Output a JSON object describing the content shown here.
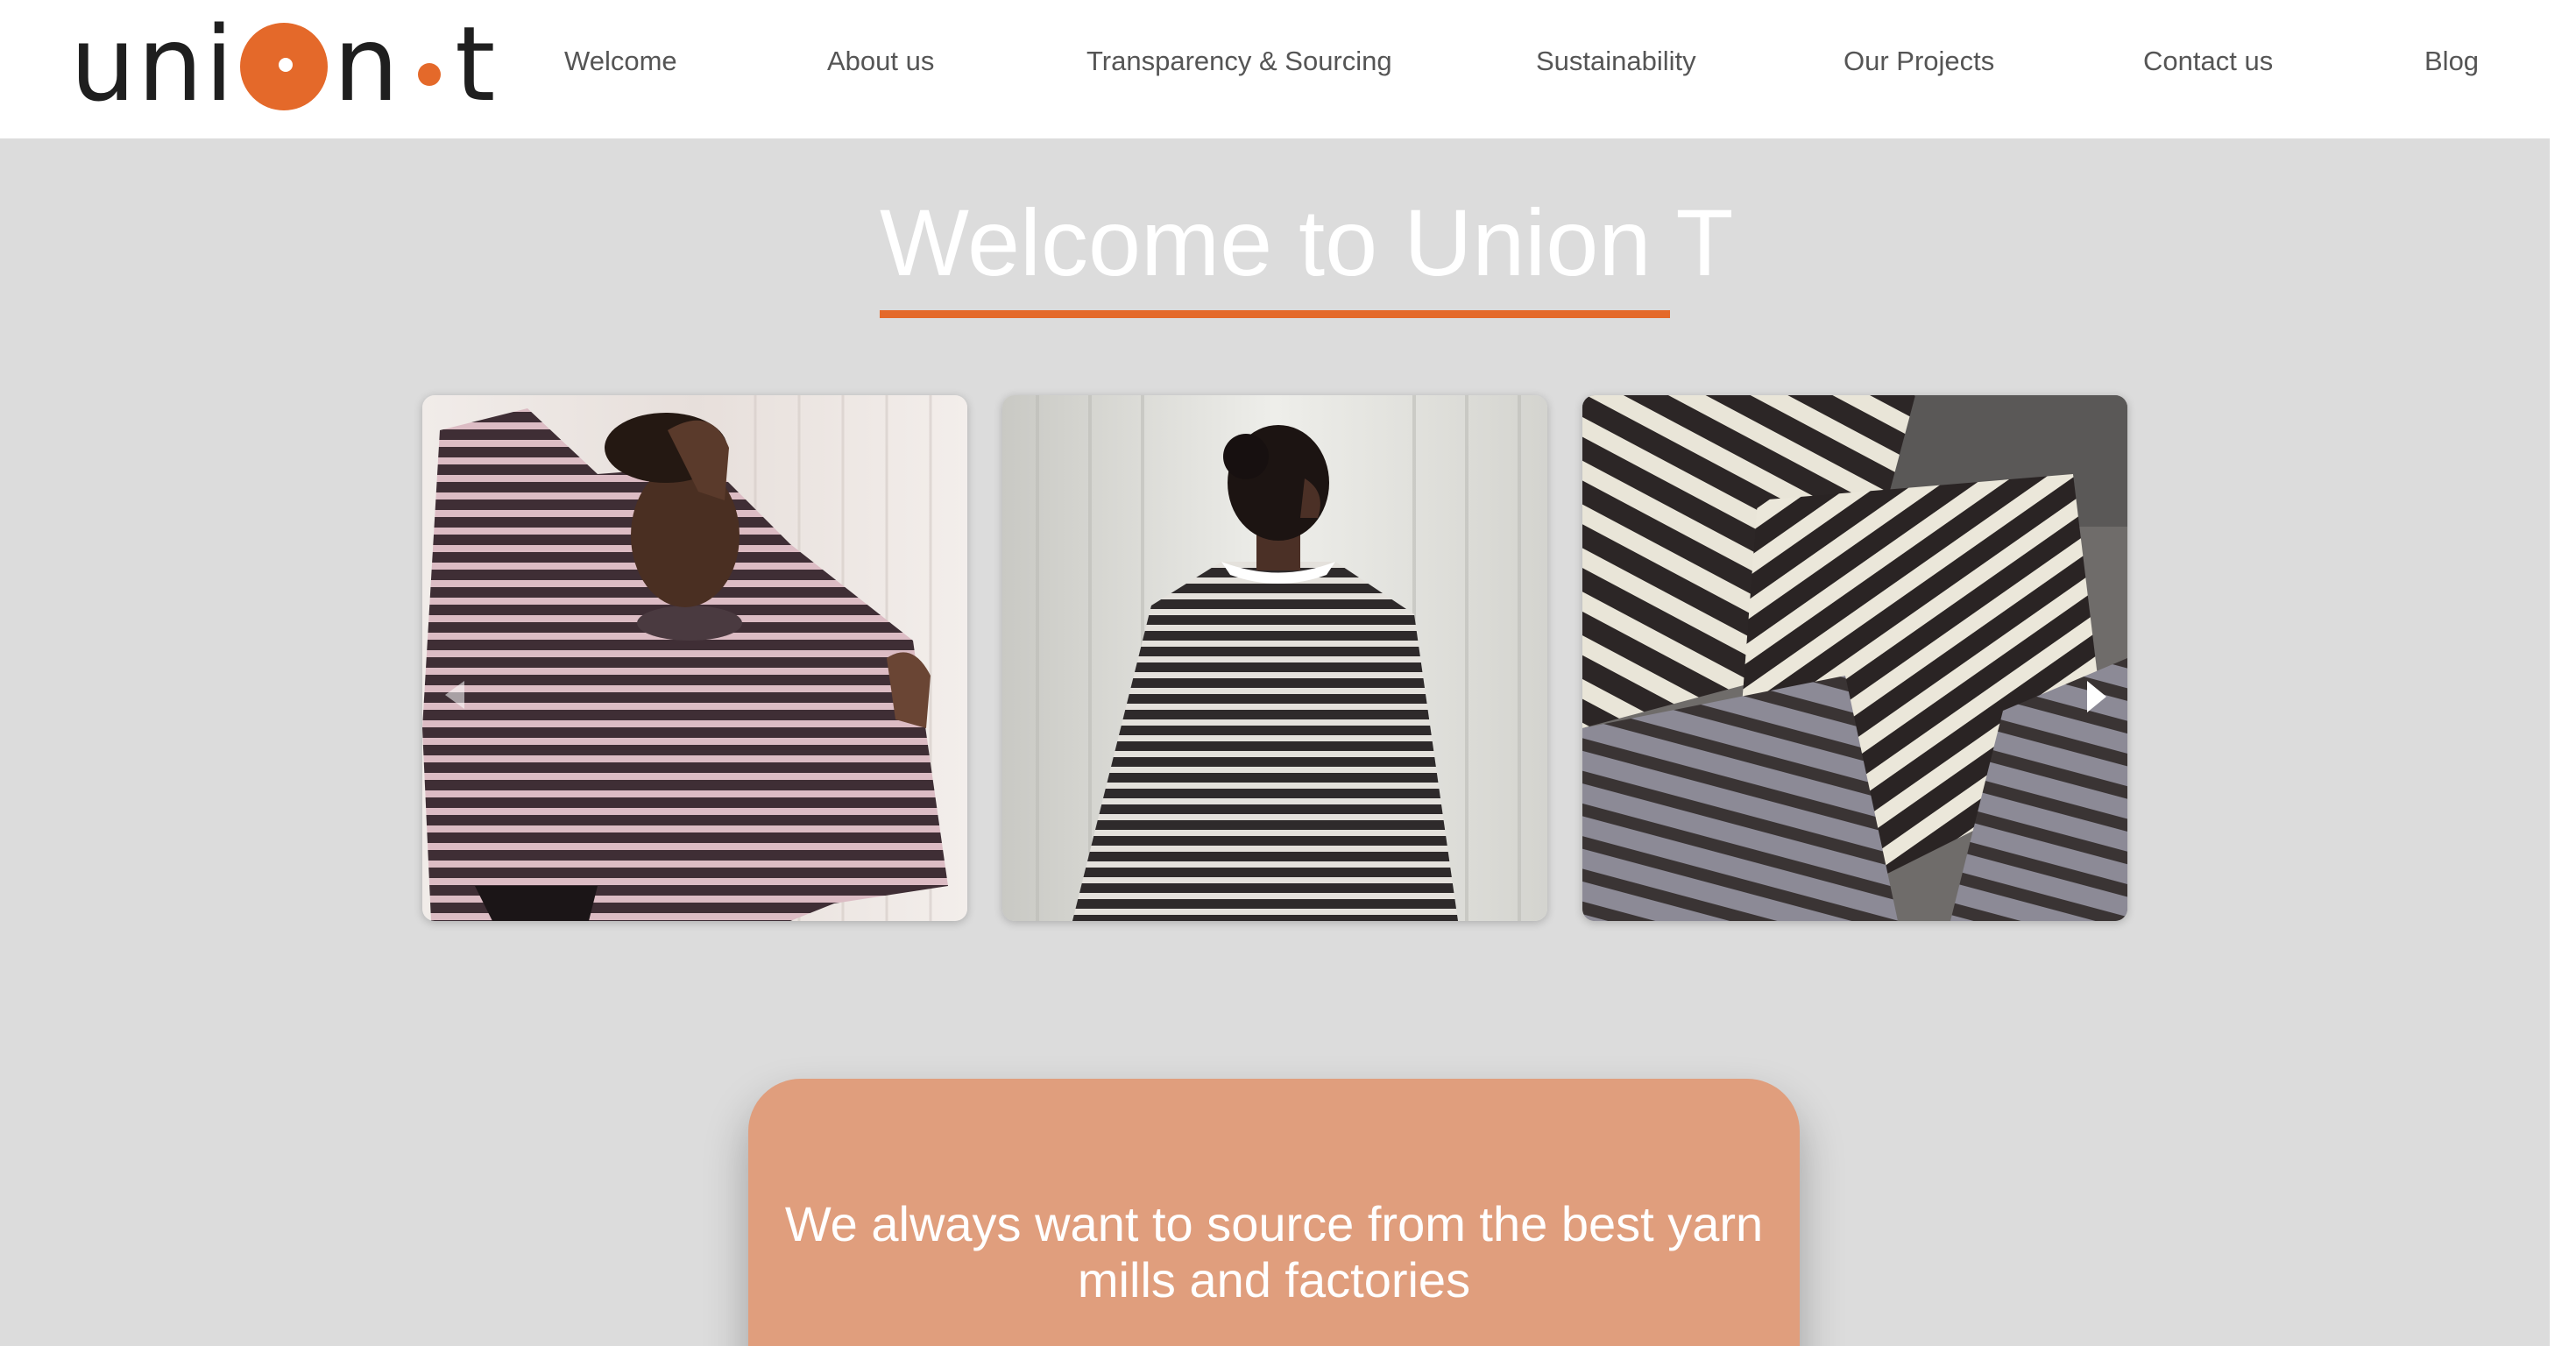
{
  "brand": {
    "logo_letters_left": "uni",
    "logo_letters_mid": "n",
    "logo_letters_right": "t",
    "accent_color": "#e4692a"
  },
  "nav": {
    "items": [
      {
        "label": "Welcome"
      },
      {
        "label": "About us"
      },
      {
        "label": "Transparency & Sourcing"
      },
      {
        "label": "Sustainability"
      },
      {
        "label": "Our Projects"
      },
      {
        "label": "Contact us"
      },
      {
        "label": "Blog"
      }
    ]
  },
  "hero": {
    "title": "Welcome to Union T"
  },
  "gallery": {
    "left_arrow_icon": "chevron-left-icon",
    "right_arrow_icon": "chevron-right-icon"
  },
  "quote": {
    "line1": "We always want to source from the best yarn",
    "line2": "mills and factories",
    "background_color": "#e09e7d"
  }
}
